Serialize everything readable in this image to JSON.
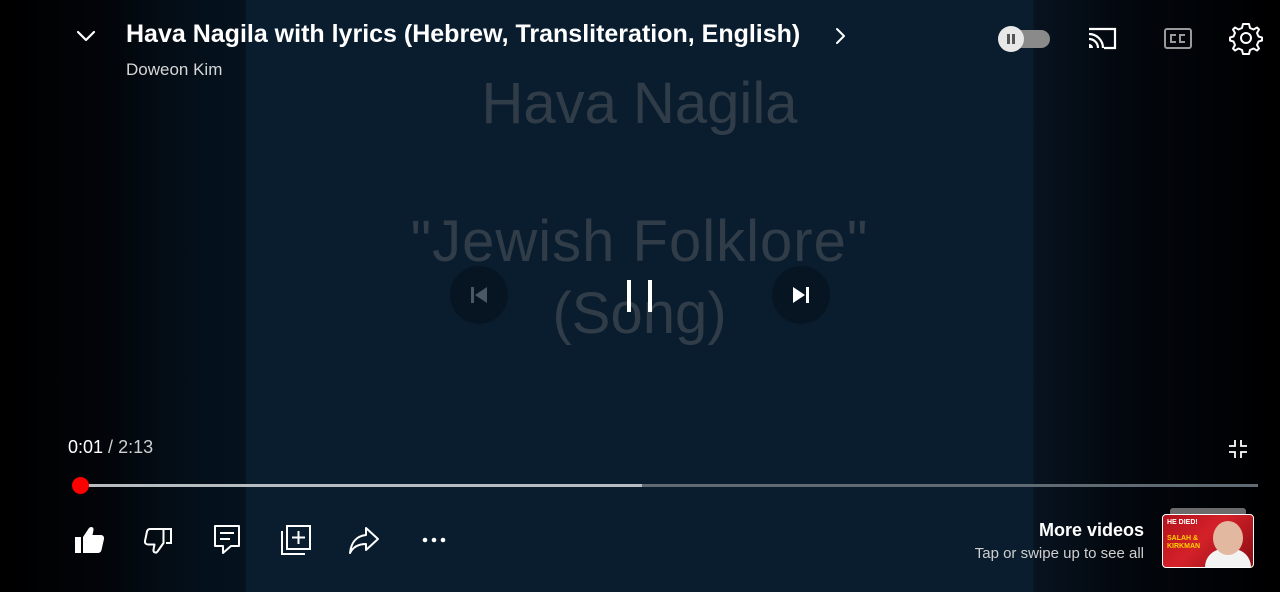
{
  "header": {
    "title": "Hava Nagila with lyrics (Hebrew, Transliteration, English)",
    "channel": "Doweon Kim"
  },
  "video_frame": {
    "title": "Hava Nagila",
    "line1": "\"Jewish Folklore\"",
    "line2": "(Song)"
  },
  "time": {
    "current": "0:01",
    "separator": " / ",
    "duration": "2:13"
  },
  "progress": {
    "played_fraction": 0.0,
    "buffered_fraction": 0.477
  },
  "more_videos": {
    "title": "More videos",
    "subtitle": "Tap or swipe up to see all"
  },
  "thumbnail": {
    "headline": "HE DIED!",
    "subline": "SALAH & KIRKMAN"
  },
  "colors": {
    "accent": "#ff0000",
    "background": "#0d2439"
  },
  "icons": {
    "collapse": "chevron-down-icon",
    "title_more": "chevron-right-icon",
    "autoplay": "autoplay-toggle",
    "cast": "cast-icon",
    "captions": "cc-icon",
    "settings": "gear-icon",
    "previous": "skip-previous-icon",
    "play_pause": "pause-icon",
    "next": "skip-next-icon",
    "fullscreen_exit": "fullscreen-exit-icon",
    "like": "thumbs-up-icon",
    "dislike": "thumbs-down-icon",
    "comment": "comment-icon",
    "save": "add-to-playlist-icon",
    "share": "share-icon",
    "more": "more-horizontal-icon"
  }
}
